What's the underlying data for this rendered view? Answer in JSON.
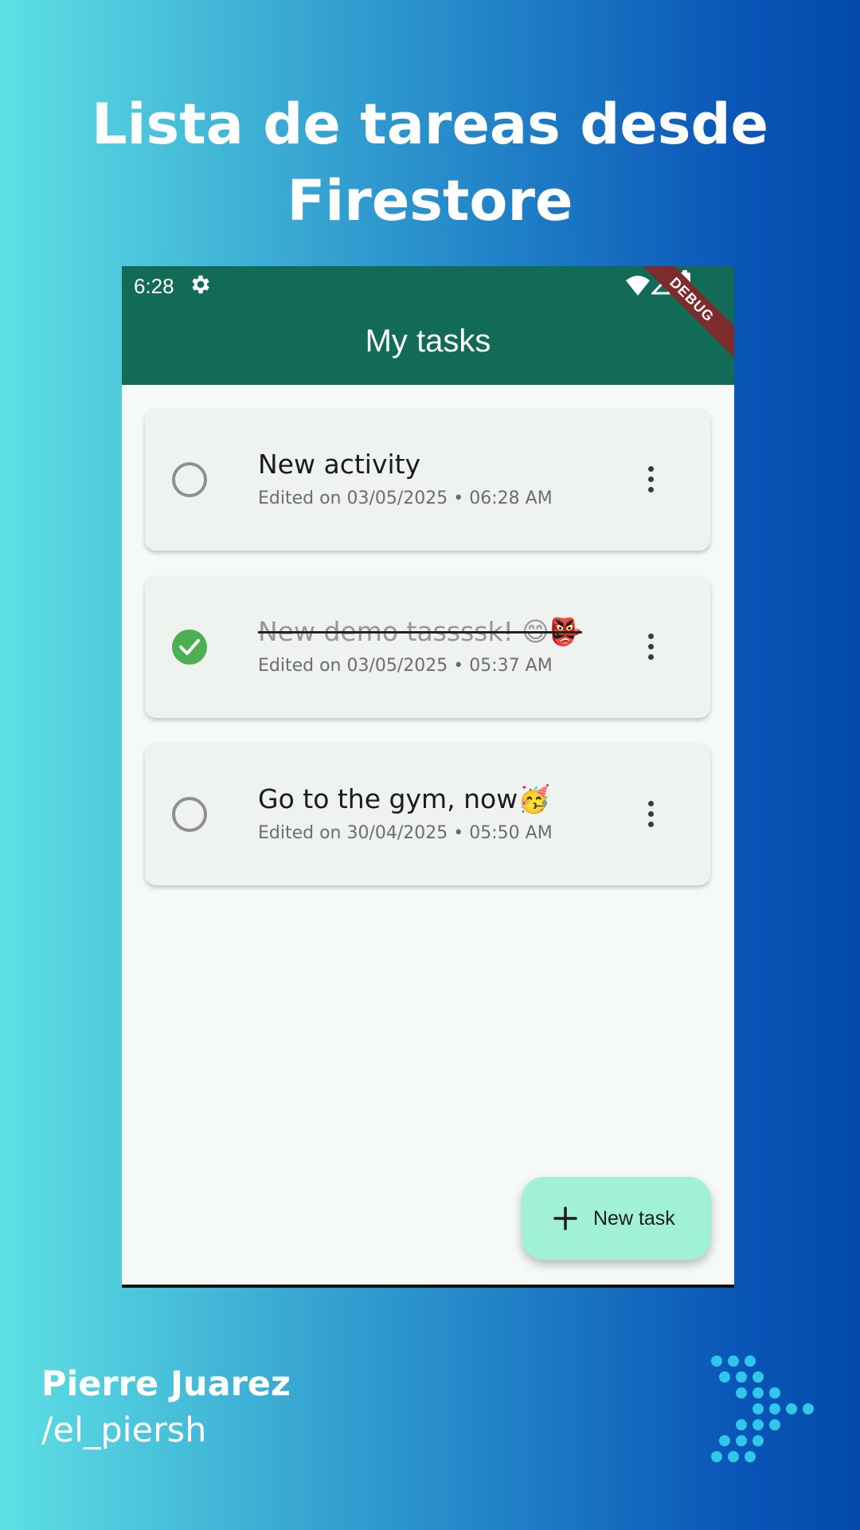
{
  "headline": "Lista de tareas desde Firestore",
  "status_bar": {
    "time": "6:28",
    "icons": [
      "gear-icon",
      "wifi-icon",
      "signal-icon",
      "battery-icon"
    ]
  },
  "debug_banner": "DEBUG",
  "app_bar": {
    "title": "My tasks"
  },
  "tasks": [
    {
      "title": "New activity",
      "subtitle": "Edited on 03/05/2025 • 06:28 AM",
      "completed": false
    },
    {
      "title": "New demo tassssk! 😄👺",
      "subtitle": "Edited on 03/05/2025 • 05:37 AM",
      "completed": true
    },
    {
      "title": "Go to the gym, now🥳",
      "subtitle": "Edited on 30/04/2025 • 05:50 AM",
      "completed": false
    }
  ],
  "fab": {
    "label": "New task",
    "icon": "plus-icon"
  },
  "author": {
    "name": "Pierre Juarez",
    "handle": "/el_piersh"
  },
  "colors": {
    "app_bar": "#116b56",
    "fab": "#a1f0d8",
    "check_done": "#4caf50",
    "debug_banner": "#7d2b2b"
  }
}
